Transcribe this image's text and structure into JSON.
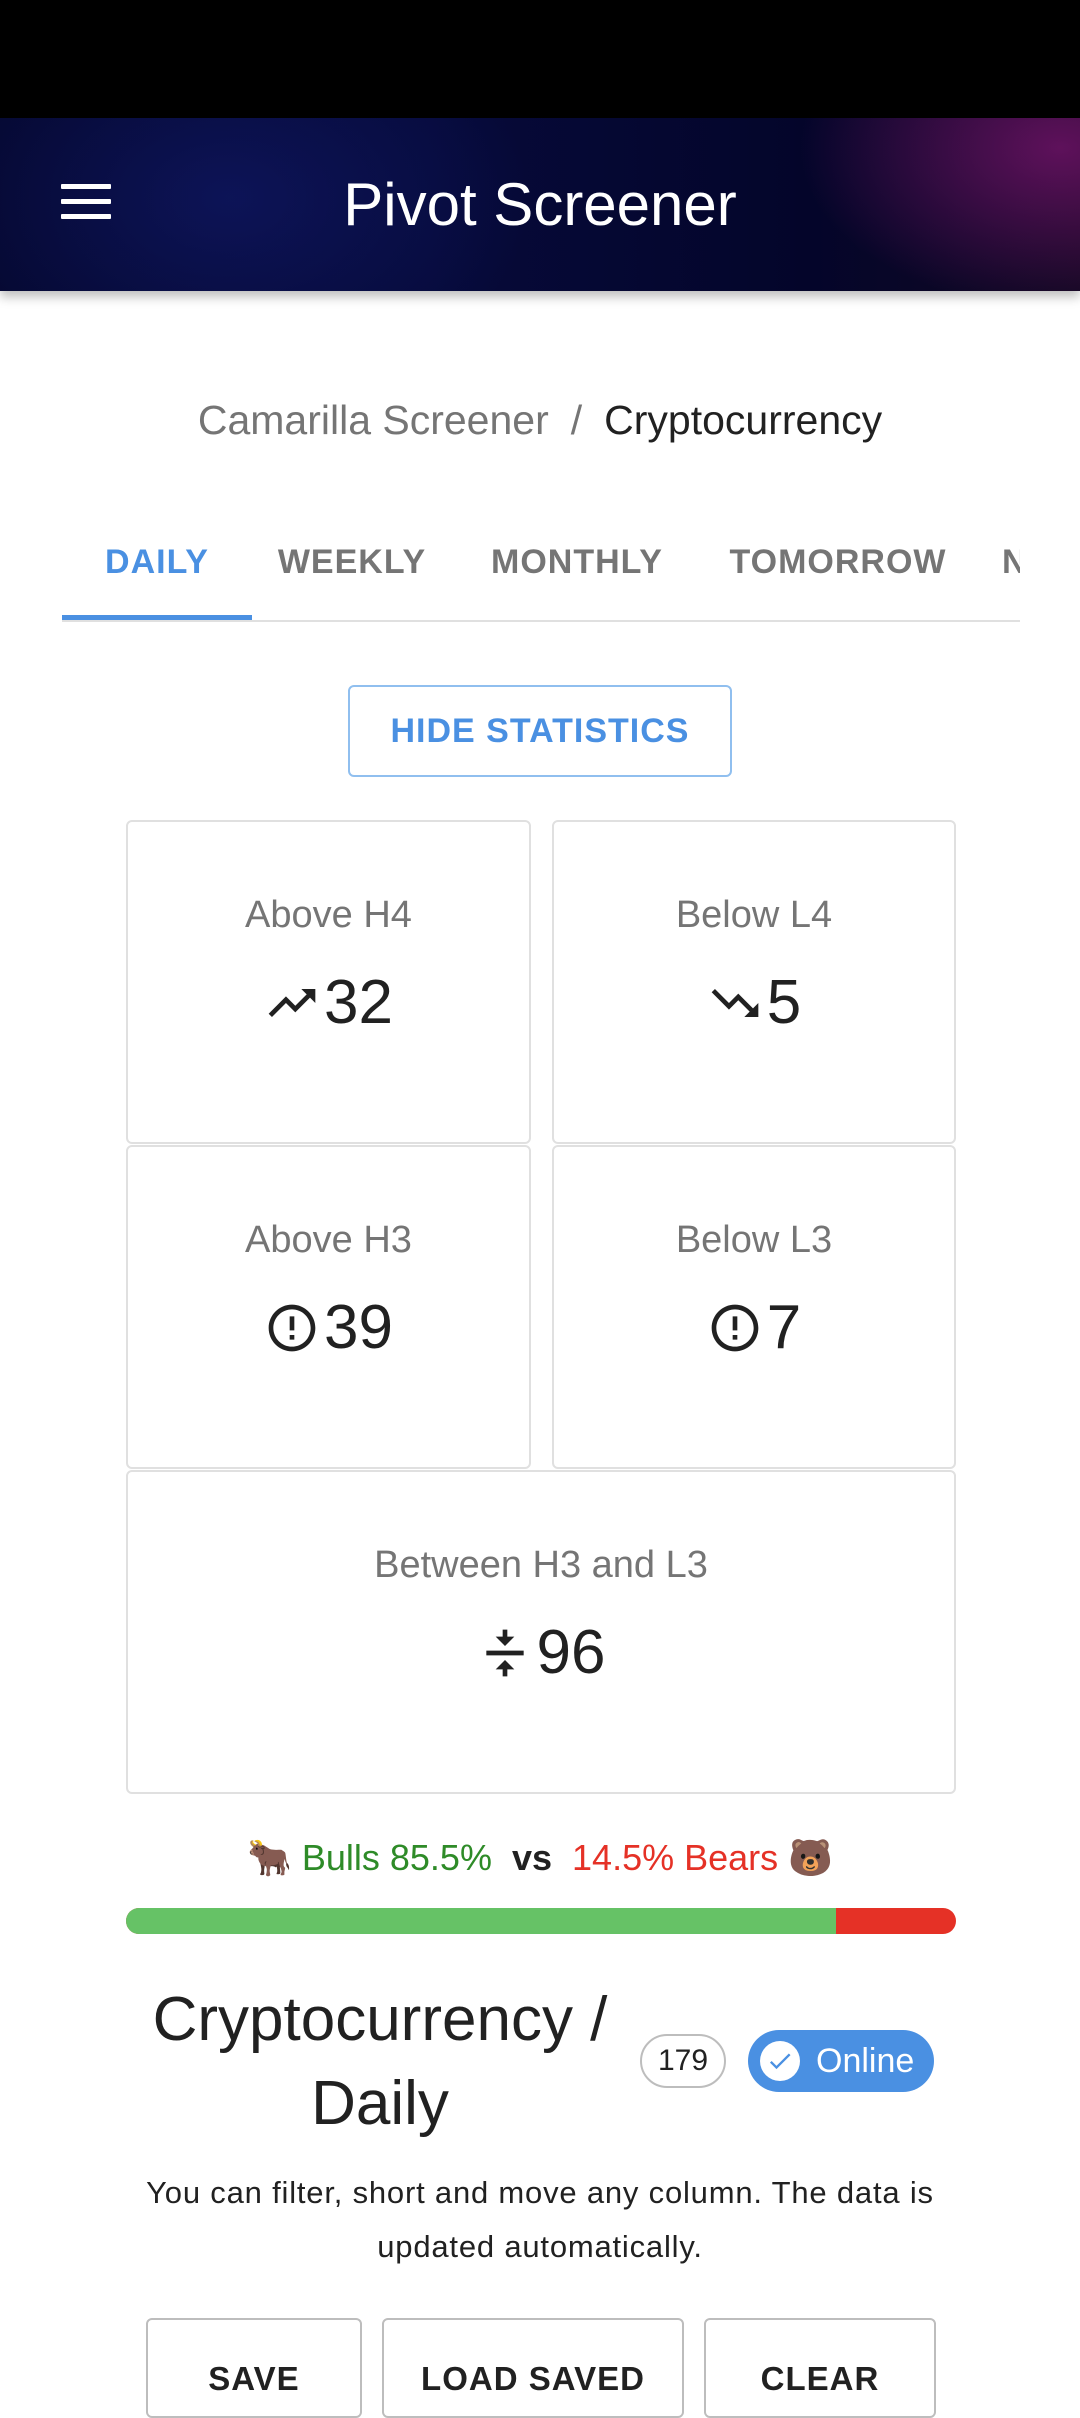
{
  "app_bar": {
    "title": "Pivot Screener",
    "menu_icon": "menu-icon"
  },
  "breadcrumb": {
    "parent": "Camarilla Screener",
    "separator": "/",
    "current": "Cryptocurrency"
  },
  "tabs": [
    {
      "label": "DAILY",
      "active": true
    },
    {
      "label": "WEEKLY",
      "active": false
    },
    {
      "label": "MONTHLY",
      "active": false
    },
    {
      "label": "TOMORROW",
      "active": false
    },
    {
      "label": "N",
      "active": false
    }
  ],
  "hide_stats_label": "HIDE STATISTICS",
  "stats": {
    "above_h4": {
      "label": "Above H4",
      "value": "32",
      "icon": "trending-up-icon"
    },
    "below_l4": {
      "label": "Below L4",
      "value": "5",
      "icon": "trending-down-icon"
    },
    "above_h3": {
      "label": "Above H3",
      "value": "39",
      "icon": "alert-circle-icon"
    },
    "below_l3": {
      "label": "Below L3",
      "value": "7",
      "icon": "alert-circle-icon"
    },
    "between": {
      "label": "Between H3 and L3",
      "value": "96",
      "icon": "compress-icon"
    }
  },
  "sentiment": {
    "bull_emoji": "🐂",
    "bulls_text": "Bulls 85.5%",
    "vs": "vs",
    "bears_text": "14.5% Bears",
    "bear_emoji": "🐻",
    "bull_percent": 85.5,
    "colors": {
      "bull": "#66c266",
      "bear": "#e53126"
    }
  },
  "section": {
    "title": "Cryptocurrency / Daily",
    "count": "179",
    "status": "Online",
    "help": "You can filter, short and move any column. The data is updated automatically."
  },
  "actions": {
    "save": "SAVE",
    "load_saved": "LOAD SAVED",
    "clear": "CLEAR"
  },
  "colors": {
    "accent": "#4a90e2"
  }
}
